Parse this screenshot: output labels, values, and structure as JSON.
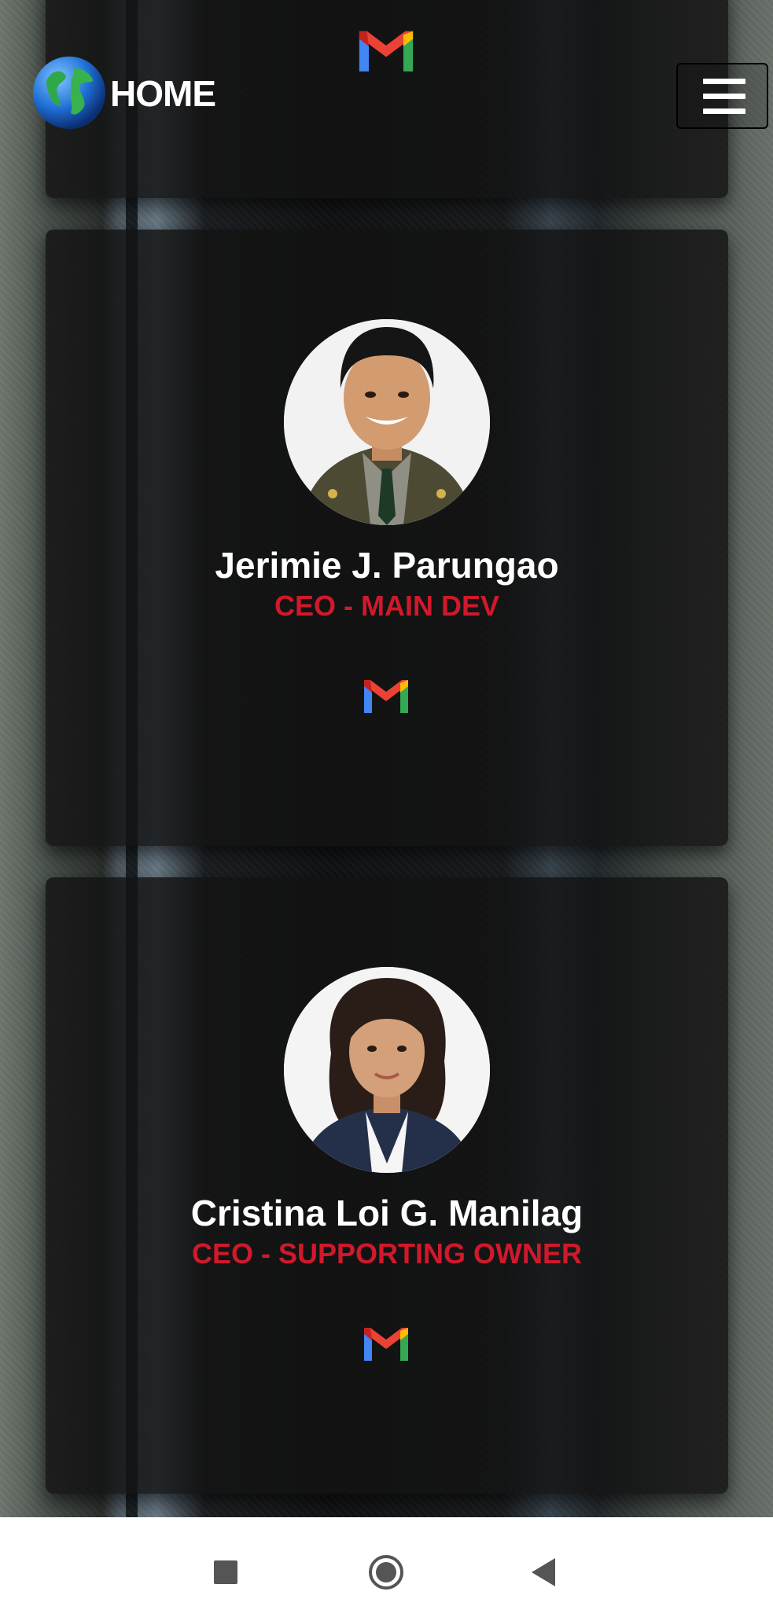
{
  "header": {
    "home_label": "HOME",
    "logo_icon": "globe-icon",
    "mail_icon": "gmail-icon",
    "menu_icon": "hamburger-menu-icon"
  },
  "team": [
    {
      "name": "Jerimie J. Parungao",
      "role": "CEO - MAIN DEV",
      "contact_icon": "gmail-icon"
    },
    {
      "name": "Cristina Loi G. Manilag",
      "role": "CEO - SUPPORTING OWNER",
      "contact_icon": "gmail-icon"
    }
  ],
  "colors": {
    "role": "#d0192b",
    "name": "#ffffff",
    "card": "#121212"
  },
  "navbar": {
    "recents_icon": "square-icon",
    "home_icon": "circle-home-icon",
    "back_icon": "back-triangle-icon"
  }
}
